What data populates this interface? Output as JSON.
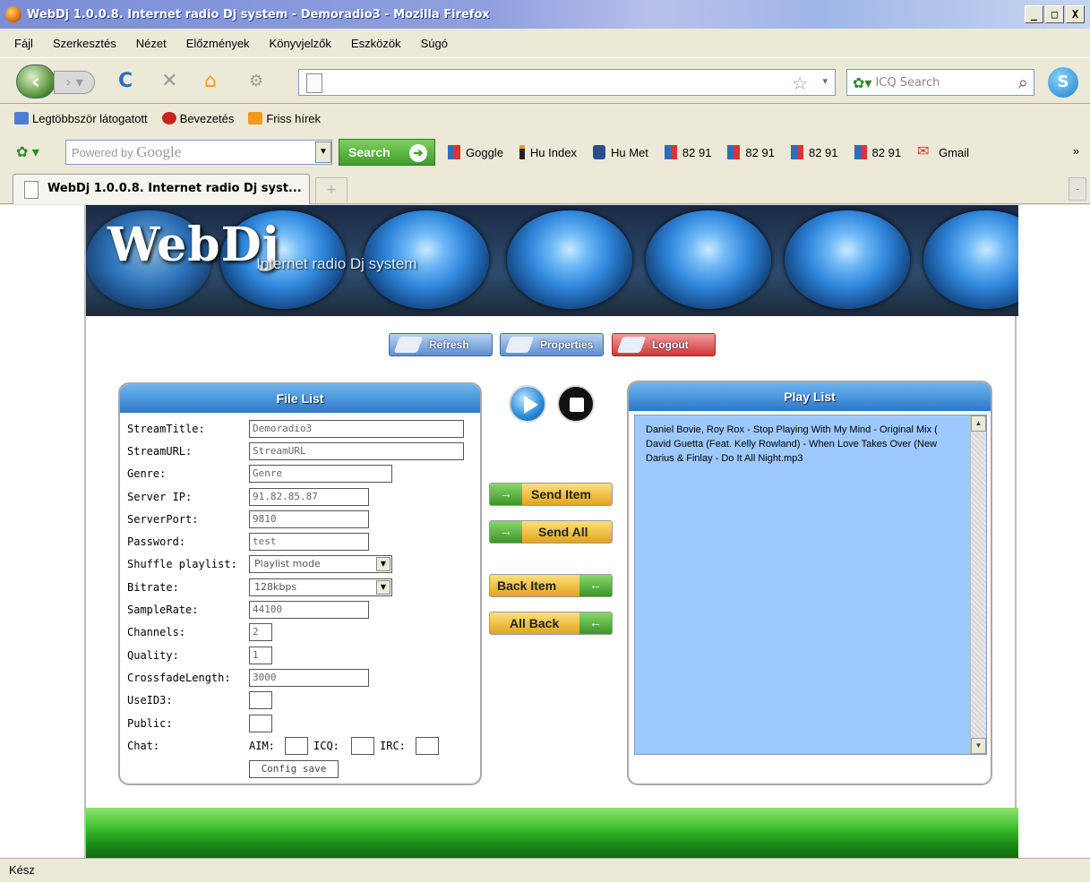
{
  "window": {
    "title": "WebDj 1.0.0.8. Internet radio Dj system - Demoradio3 - Mozilla Firefox",
    "min": "_",
    "max": "□",
    "close": "X"
  },
  "menu": [
    "Fájl",
    "Szerkesztés",
    "Nézet",
    "Előzmények",
    "Könyvjelzők",
    "Eszközök",
    "Súgó"
  ],
  "nav": {
    "url": "",
    "search_placeholder": "ICQ Search"
  },
  "bookmarks": [
    "Legtöbbször látogatott",
    "Bevezetés",
    "Friss hírek"
  ],
  "google_bar": {
    "placeholder_prefix": "Powered by ",
    "placeholder_brand": "Google",
    "search_label": "Search",
    "links": [
      "Goggle",
      "Hu Index",
      "Hu Met",
      "82 91",
      "82 91",
      "82 91",
      "82 91",
      "Gmail"
    ],
    "more": "»"
  },
  "tab": {
    "title": "WebDj 1.0.0.8. Internet radio Dj syst...",
    "new": "+",
    "scroll": "-"
  },
  "banner": {
    "logo": "WebDj",
    "subtitle": "Internet radio Dj system"
  },
  "toolbar": {
    "refresh": "Refresh",
    "properties": "Properties",
    "logout": "Logout"
  },
  "file_list": {
    "title": "File List",
    "fields": {
      "stream_title": {
        "label": "StreamTitle:",
        "value": "Demoradio3"
      },
      "stream_url": {
        "label": "StreamURL:",
        "value": "StreamURL"
      },
      "genre": {
        "label": "Genre:",
        "value": "Genre"
      },
      "server_ip": {
        "label": "Server IP:",
        "value": "91.82.85.87"
      },
      "server_port": {
        "label": "ServerPort:",
        "value": "9810"
      },
      "password": {
        "label": "Password:",
        "value": "test"
      },
      "shuffle": {
        "label": "Shuffle playlist:",
        "value": "Playlist mode"
      },
      "bitrate": {
        "label": "Bitrate:",
        "value": "128kbps"
      },
      "samplerate": {
        "label": "SampleRate:",
        "value": "44100"
      },
      "channels": {
        "label": "Channels:",
        "value": "2"
      },
      "quality": {
        "label": "Quality:",
        "value": "1"
      },
      "crossfade": {
        "label": "CrossfadeLength:",
        "value": "3000"
      },
      "useid3": {
        "label": "UseID3:"
      },
      "public": {
        "label": "Public:"
      },
      "chat": {
        "label": "Chat:",
        "aim": "AIM:",
        "icq": "ICQ:",
        "irc": "IRC:"
      }
    },
    "config_save": "Config save"
  },
  "actions": {
    "send_item": "Send Item",
    "send_all": "Send All",
    "back_item": "Back Item",
    "all_back": "All Back",
    "arrow_right": "→",
    "arrow_left": "←"
  },
  "play_list": {
    "title": "Play List",
    "items": [
      "Daniel Bovie, Roy Rox - Stop Playing With My Mind - Original Mix (",
      "David Guetta (Feat. Kelly Rowland) - When Love Takes Over (New",
      "Darius & Finlay - Do It All Night.mp3"
    ],
    "scroll_up": "▲",
    "scroll_down": "▼"
  },
  "status": "Kész"
}
